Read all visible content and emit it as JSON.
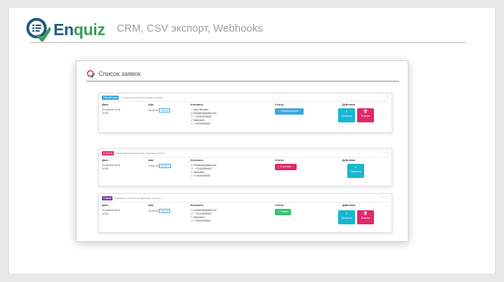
{
  "brand": {
    "name_main": "En",
    "name_accent": "quiz",
    "subtitle": "CRM, CSV экспорт, Webhooks",
    "colors": {
      "dark": "#1f5b7e",
      "green": "#3a9d5a"
    }
  },
  "panel": {
    "title": "Список заявок"
  },
  "columns": {
    "date": "Дата",
    "step": "Шаг",
    "contacts": "Контакты",
    "status": "Статус",
    "actions": "Действия"
  },
  "cards": [
    {
      "tag": "Обработано",
      "tag_color": "#3da5e0",
      "title": "Сколько вы хотите делать ремонт",
      "date": "15 апреля 2018",
      "time": "10:06",
      "step_time": "10:45:15",
      "step_tag": "Начало",
      "contacts": {
        "name": "Alex Bochkin",
        "email": "bochkin@gmail.com",
        "phone": "+71020009400",
        "nick": "Nickname",
        "extra": "+71020009400"
      },
      "status": "Обработанный",
      "actions": {
        "view": "Просмотр",
        "cart": "В архив"
      }
    },
    {
      "tag": "В архив",
      "tag_color": "#e2286b",
      "title": "Какая фото/ниша в вас подходит лично",
      "date": "15 апреля 2018",
      "time": "10:06",
      "step_time": "6 мин 10",
      "step_tag": "Начало",
      "contacts": {
        "email": "bochkin@gmail.com",
        "phone": "+71020009400",
        "nick": "Nickname",
        "extra": "+71020009400"
      },
      "status": "В архиве",
      "actions": {
        "view": "Просмотр"
      }
    },
    {
      "tag": "Новый",
      "tag_color": "#7b3ea8",
      "title": "Выберите по вам продающие товары",
      "date": "15 апреля 2018",
      "time": "10:06",
      "step_time": "10:45:15",
      "step_tag": "Начало",
      "contacts": {
        "email": "bochkin@gmail.com",
        "phone": "+71020009400",
        "nick": "Nickname",
        "extra": "+71020009400"
      },
      "status": "Новый",
      "actions": {
        "view": "Просмотр",
        "cart": "В архив"
      }
    }
  ]
}
